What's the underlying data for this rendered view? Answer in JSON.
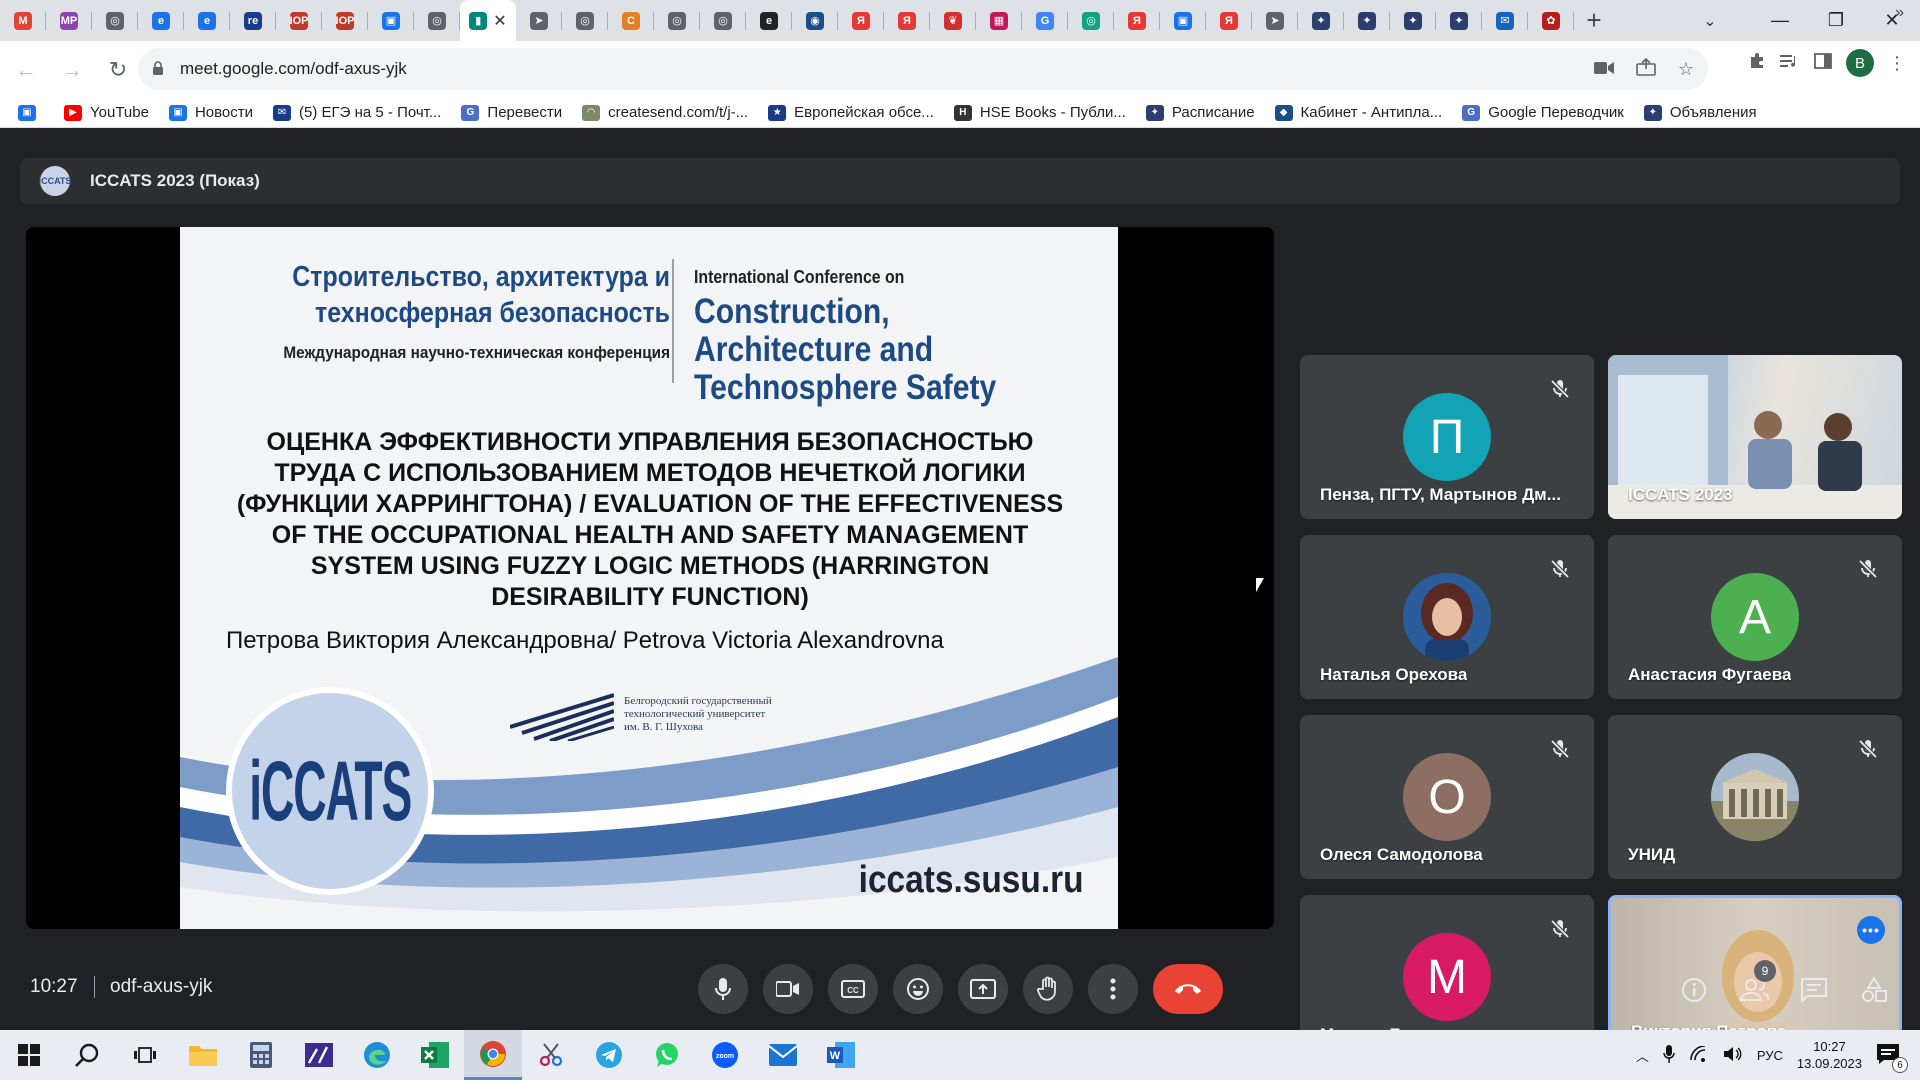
{
  "browser": {
    "url": "meet.google.com/odf-axus-yjk",
    "profile_initial": "В",
    "tab_favicons": [
      {
        "name": "gmail",
        "color": "#e04436",
        "glyph": "M"
      },
      {
        "name": "mp",
        "color": "#8e44ad",
        "glyph": "MP"
      },
      {
        "name": "globe",
        "color": "#5f6368",
        "glyph": "◎"
      },
      {
        "name": "edge1",
        "color": "#1a73e8",
        "glyph": "e"
      },
      {
        "name": "edge2",
        "color": "#1a73e8",
        "glyph": "e"
      },
      {
        "name": "re",
        "color": "#1a3a8a",
        "glyph": "re"
      },
      {
        "name": "iop1",
        "color": "#c0392b",
        "glyph": "IOP"
      },
      {
        "name": "iop2",
        "color": "#c0392b",
        "glyph": "IOP"
      },
      {
        "name": "chat",
        "color": "#1a73e8",
        "glyph": "▣"
      },
      {
        "name": "globe2",
        "color": "#5f6368",
        "glyph": "◎"
      },
      {
        "name": "meet",
        "color": "#00897b",
        "glyph": "▮"
      },
      {
        "name": "plane1",
        "color": "#5f6368",
        "glyph": "➤"
      },
      {
        "name": "globe3",
        "color": "#5f6368",
        "glyph": "◎"
      },
      {
        "name": "c",
        "color": "#e67e22",
        "glyph": "C"
      },
      {
        "name": "globe4",
        "color": "#5f6368",
        "glyph": "◎"
      },
      {
        "name": "globe5",
        "color": "#5f6368",
        "glyph": "◎"
      },
      {
        "name": "e-black",
        "color": "#222222",
        "glyph": "e"
      },
      {
        "name": "eye",
        "color": "#1a4e8a",
        "glyph": "◉"
      },
      {
        "name": "ya1",
        "color": "#e53935",
        "glyph": "Я"
      },
      {
        "name": "ya2",
        "color": "#e53935",
        "glyph": "Я"
      },
      {
        "name": "bird",
        "color": "#d32f2f",
        "glyph": "❦"
      },
      {
        "name": "grid",
        "color": "#c2185b",
        "glyph": "▦"
      },
      {
        "name": "google",
        "color": "#4285f4",
        "glyph": "G"
      },
      {
        "name": "openai",
        "color": "#10a37f",
        "glyph": "◎"
      },
      {
        "name": "ya3",
        "color": "#e53935",
        "glyph": "Я"
      },
      {
        "name": "cube",
        "color": "#1a73e8",
        "glyph": "▣"
      },
      {
        "name": "ya4",
        "color": "#e53935",
        "glyph": "Я"
      },
      {
        "name": "plane2",
        "color": "#5f6368",
        "glyph": "➤"
      },
      {
        "name": "leaf1",
        "color": "#2c3e70",
        "glyph": "✦"
      },
      {
        "name": "leaf2",
        "color": "#2c3e70",
        "glyph": "✦"
      },
      {
        "name": "leaf3",
        "color": "#2c3e70",
        "glyph": "✦"
      },
      {
        "name": "leaf4",
        "color": "#2c3e70",
        "glyph": "✦"
      },
      {
        "name": "mail",
        "color": "#1565c0",
        "glyph": "✉"
      },
      {
        "name": "flower",
        "color": "#b71c1c",
        "glyph": "✿"
      }
    ],
    "bookmarks": [
      {
        "label": "",
        "color": "#1a73e8",
        "glyph": "▣"
      },
      {
        "label": "YouTube",
        "color": "#ff0000",
        "glyph": "▶"
      },
      {
        "label": "Новости",
        "color": "#1a73e8",
        "glyph": "▣"
      },
      {
        "label": "(5) ЕГЭ на 5 - Почт...",
        "color": "#1a3a8a",
        "glyph": "✉"
      },
      {
        "label": "Перевести",
        "color": "#4a6fc4",
        "glyph": "G"
      },
      {
        "label": "createsend.com/t/j-...",
        "color": "#7a8a6a",
        "glyph": "◠"
      },
      {
        "label": "Европейская обсе...",
        "color": "#1a3a8a",
        "glyph": "★"
      },
      {
        "label": "HSE Books - Публи...",
        "color": "#333333",
        "glyph": "H"
      },
      {
        "label": "Расписание",
        "color": "#2c3e70",
        "glyph": "✦"
      },
      {
        "label": "Кабинет - Антипла...",
        "color": "#1a4e8a",
        "glyph": "◆"
      },
      {
        "label": "Google Переводчик",
        "color": "#4a6fc4",
        "glyph": "G"
      },
      {
        "label": "Объявления",
        "color": "#2c3e70",
        "glyph": "✦"
      }
    ]
  },
  "meet": {
    "title": "ICCATS 2023 (Показ)",
    "clock": "10:27",
    "meeting_code": "odf-axus-yjk",
    "participant_count": "9",
    "slide": {
      "ru_title": "Строительство, архитектура и техносферная безопасность",
      "ru_subtitle": "Международная научно-техническая конференция",
      "en_pre": "International Conference on",
      "en_title": "Construction, Architecture and Technosphere Safety",
      "paper_title": "ОЦЕНКА ЭФФЕКТИВНОСТИ УПРАВЛЕНИЯ БЕЗОПАСНОСТЬЮ ТРУДА С ИСПОЛЬЗОВАНИЕМ МЕТОДОВ НЕЧЕТКОЙ ЛОГИКИ (ФУНКЦИИ ХАРРИНГТОНА) / EVALUATION OF THE EFFECTIVENESS OF THE OCCUPATIONAL HEALTH AND SAFETY MANAGEMENT SYSTEM USING FUZZY LOGIC METHODS (HARRINGTON DESIRABILITY FUNCTION)",
      "author": "Петрова Виктория Александровна/ Petrova Victoria Alexandrovna",
      "university_lines": [
        "Белгородский государственный",
        "технологический университет",
        "им. В. Г. Шухова"
      ],
      "logo_text": "iCCATS",
      "url": "iccats.susu.ru"
    },
    "participants": [
      {
        "name": "Пенза, ПГТУ, Мартынов Дм...",
        "initial": "П",
        "color": "#12a4b4",
        "muted": true,
        "kind": "initial"
      },
      {
        "name": "ICCATS 2023",
        "initial": "",
        "color": "#b9c7d3",
        "muted": false,
        "kind": "video"
      },
      {
        "name": "Наталья Орехова",
        "initial": "",
        "color": "#2a5d9a",
        "muted": true,
        "kind": "photo"
      },
      {
        "name": "Анастасия Фугаева",
        "initial": "А",
        "color": "#4caf50",
        "muted": true,
        "kind": "initial"
      },
      {
        "name": "Олеся Самодолова",
        "initial": "О",
        "color": "#8d6e63",
        "muted": true,
        "kind": "initial"
      },
      {
        "name": "УНИД",
        "initial": "",
        "color": "#8a8f72",
        "muted": true,
        "kind": "photo"
      },
      {
        "name": "Михаил Брюхов",
        "initial": "М",
        "color": "#d81b60",
        "muted": true,
        "kind": "initial"
      },
      {
        "name": "Виктория Петрова",
        "initial": "",
        "color": "#c9c2b4",
        "muted": false,
        "kind": "selected-video"
      }
    ]
  },
  "taskbar": {
    "lang": "РУС",
    "time": "10:27",
    "date": "13.09.2023",
    "notifications": "6"
  }
}
